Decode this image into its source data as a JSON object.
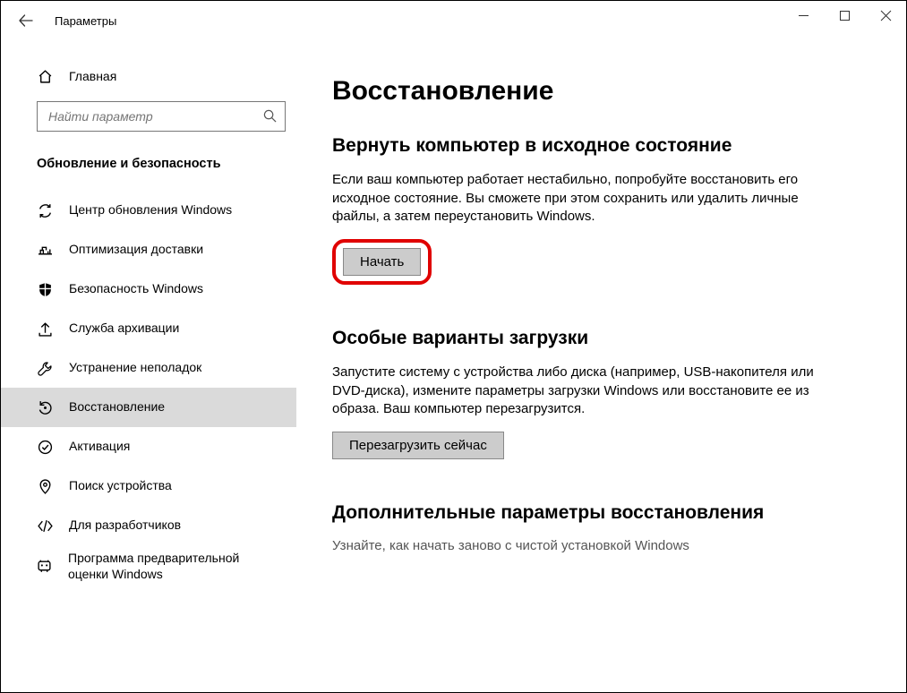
{
  "window": {
    "title": "Параметры"
  },
  "sidebar": {
    "home_label": "Главная",
    "search_placeholder": "Найти параметр",
    "section_title": "Обновление и безопасность",
    "items": [
      {
        "label": "Центр обновления Windows"
      },
      {
        "label": "Оптимизация доставки"
      },
      {
        "label": "Безопасность Windows"
      },
      {
        "label": "Служба архивации"
      },
      {
        "label": "Устранение неполадок"
      },
      {
        "label": "Восстановление",
        "active": true
      },
      {
        "label": "Активация"
      },
      {
        "label": "Поиск устройства"
      },
      {
        "label": "Для разработчиков"
      },
      {
        "label": "Программа предварительной оценки Windows"
      }
    ]
  },
  "main": {
    "page_title": "Восстановление",
    "reset": {
      "heading": "Вернуть компьютер в исходное состояние",
      "body": "Если ваш компьютер работает нестабильно, попробуйте восстановить его исходное состояние. Вы сможете при этом сохранить или удалить личные файлы, а затем переустановить Windows.",
      "button": "Начать"
    },
    "advanced": {
      "heading": "Особые варианты загрузки",
      "body": "Запустите систему с устройства либо диска (например, USB-накопителя или DVD-диска), измените параметры загрузки Windows или восстановите ее из образа. Ваш компьютер перезагрузится.",
      "button": "Перезагрузить сейчас"
    },
    "more": {
      "heading": "Дополнительные параметры восстановления",
      "link": "Узнайте, как начать заново с чистой установкой Windows"
    }
  }
}
